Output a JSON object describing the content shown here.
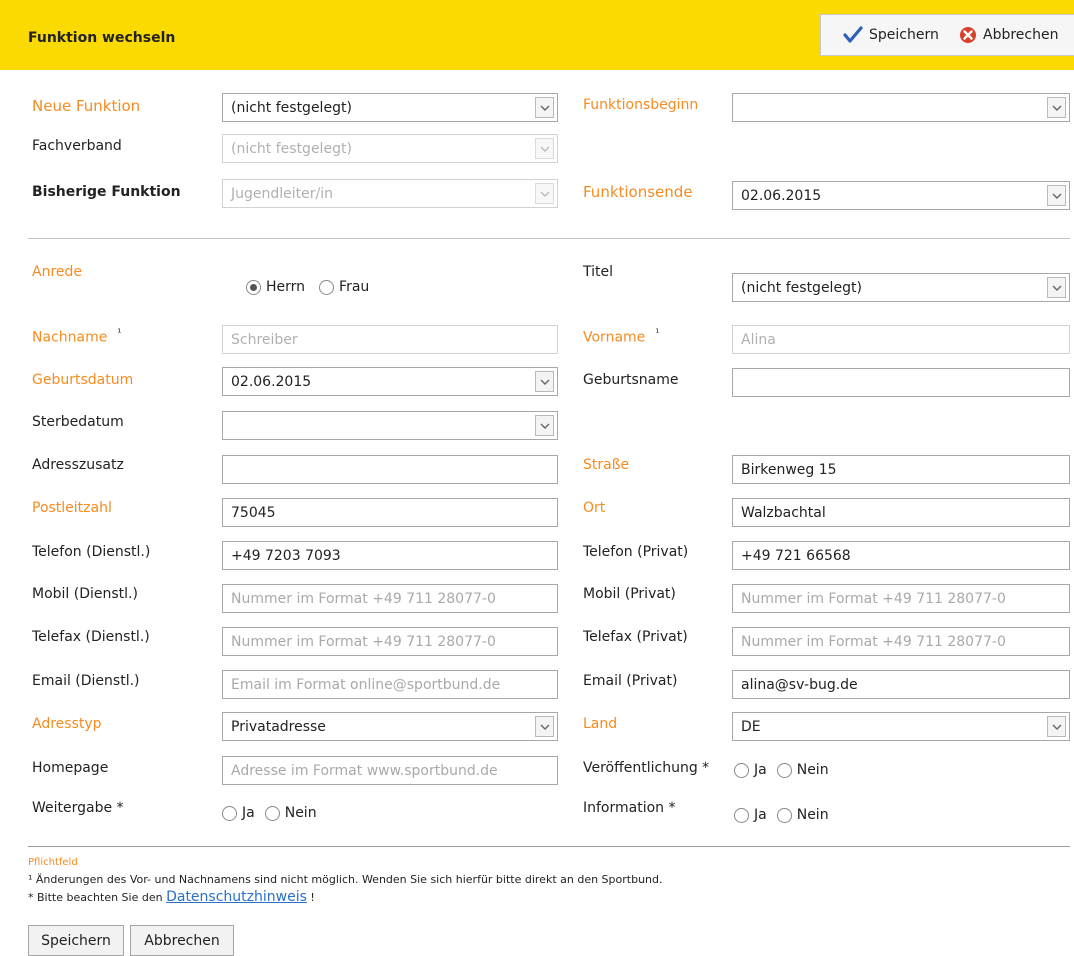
{
  "header": {
    "title": "Funktion wechseln",
    "save_label": "Speichern",
    "cancel_label": "Abbrechen"
  },
  "function": {
    "neue_funktion": {
      "label": "Neue Funktion",
      "value": "(nicht festgelegt)"
    },
    "fachverband": {
      "label": "Fachverband",
      "value": "(nicht festgelegt)"
    },
    "bisherige_funktion": {
      "label": "Bisherige Funktion",
      "value": "Jugendleiter/in"
    },
    "funktionsbeginn": {
      "label": "Funktionsbeginn",
      "value": ""
    },
    "funktionsende": {
      "label": "Funktionsende",
      "value": "02.06.2015"
    }
  },
  "person": {
    "anrede": {
      "label": "Anrede",
      "options": [
        "Herrn",
        "Frau"
      ],
      "selected": "Herrn"
    },
    "titel": {
      "label": "Titel",
      "value": "(nicht festgelegt)"
    },
    "nachname": {
      "label": "Nachname",
      "marker": "¹",
      "value": "Schreiber"
    },
    "vorname": {
      "label": "Vorname",
      "marker": "¹",
      "value": "Alina"
    },
    "geburtsdatum": {
      "label": "Geburtsdatum",
      "value": "02.06.2015"
    },
    "geburtsname": {
      "label": "Geburtsname",
      "value": ""
    },
    "sterbedatum": {
      "label": "Sterbedatum",
      "value": ""
    },
    "adresszusatz": {
      "label": "Adresszusatz",
      "value": ""
    },
    "strasse": {
      "label": "Straße",
      "value": "Birkenweg 15"
    },
    "postleitzahl": {
      "label": "Postleitzahl",
      "value": "75045"
    },
    "ort": {
      "label": "Ort",
      "value": "Walzbachtal"
    },
    "telefon_dienstl": {
      "label": "Telefon (Dienstl.)",
      "value": "+49 7203 7093"
    },
    "telefon_privat": {
      "label": "Telefon (Privat)",
      "value": "+49 721 66568"
    },
    "mobil_dienstl": {
      "label": "Mobil (Dienstl.)",
      "placeholder": "Nummer im Format +49 711 28077-0"
    },
    "mobil_privat": {
      "label": "Mobil (Privat)",
      "placeholder": "Nummer im Format +49 711 28077-0"
    },
    "telefax_dienstl": {
      "label": "Telefax (Dienstl.)",
      "placeholder": "Nummer im Format +49 711 28077-0"
    },
    "telefax_privat": {
      "label": "Telefax (Privat)",
      "placeholder": "Nummer im Format +49 711 28077-0"
    },
    "email_dienstl": {
      "label": "Email (Dienstl.)",
      "placeholder": "Email im Format online@sportbund.de"
    },
    "email_privat": {
      "label": "Email (Privat)",
      "value": "alina@sv-bug.de"
    },
    "adresstyp": {
      "label": "Adresstyp",
      "value": "Privatadresse"
    },
    "land": {
      "label": "Land",
      "value": "DE"
    },
    "homepage": {
      "label": "Homepage",
      "placeholder": "Adresse im Format www.sportbund.de"
    },
    "veroeffentlichung": {
      "label": "Veröffentlichung *",
      "options": [
        "Ja",
        "Nein"
      ]
    },
    "weitergabe": {
      "label": "Weitergabe *",
      "options": [
        "Ja",
        "Nein"
      ]
    },
    "information": {
      "label": "Information *",
      "options": [
        "Ja",
        "Nein"
      ]
    }
  },
  "footer": {
    "pflichtfeld": "Pflichtfeld",
    "note1": "¹ Änderungen des Vor- und Nachnamens sind nicht möglich. Wenden Sie sich hierfür bitte direkt an den Sportbund.",
    "note2_prefix": "* Bitte beachten Sie den",
    "note2_link": "Datenschutzhinweis",
    "note2_suffix": "!",
    "save_label": "Speichern",
    "cancel_label": "Abbrechen"
  },
  "colors": {
    "header_bg": "#fbda02",
    "required_label": "#f68b1f",
    "link": "#2a6fc9"
  }
}
